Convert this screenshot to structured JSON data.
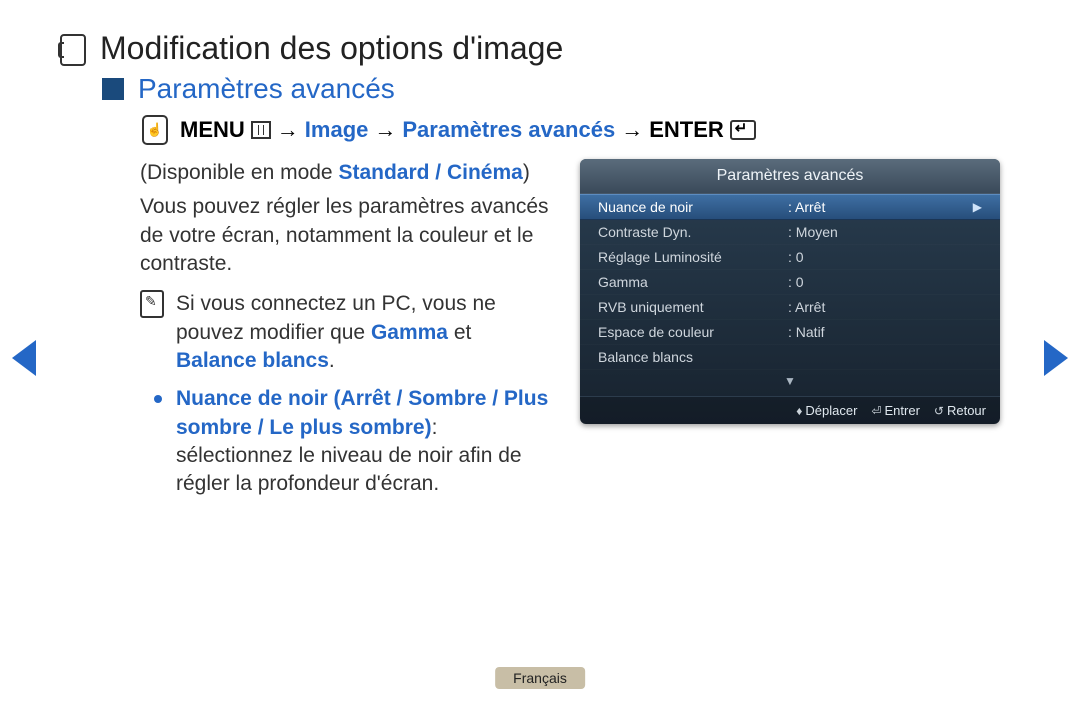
{
  "title": "Modification des options d'image",
  "subtitle": "Paramètres avancés",
  "breadcrumb": {
    "menu": "MENU",
    "arrow": "→",
    "path1": "Image",
    "path2": "Paramètres avancés",
    "enter": "ENTER"
  },
  "body": {
    "mode_prefix": "(Disponible en mode ",
    "mode1": "Standard",
    "mode_sep": " / ",
    "mode2": "Cinéma",
    "mode_suffix": ")",
    "para1": "Vous pouvez régler les paramètres avancés de votre écran, notamment la couleur et le contraste.",
    "note_prefix": "Si vous connectez un PC, vous ne pouvez modifier que ",
    "note_kw1": "Gamma",
    "note_join": " et ",
    "note_kw2": "Balance blancs",
    "note_suffix": ".",
    "bullet_title": "Nuance de noir (Arrêt / Sombre / Plus sombre / Le plus sombre)",
    "bullet_colon": ": ",
    "bullet_text": "sélectionnez le niveau de noir afin de régler la profondeur d'écran."
  },
  "osd": {
    "title": "Paramètres avancés",
    "items": [
      {
        "label": "Nuance de noir",
        "value": ": Arrêt"
      },
      {
        "label": "Contraste Dyn.",
        "value": ": Moyen"
      },
      {
        "label": "Réglage Luminosité",
        "value": ": 0"
      },
      {
        "label": "Gamma",
        "value": ": 0"
      },
      {
        "label": "RVB uniquement",
        "value": ": Arrêt"
      },
      {
        "label": "Espace de couleur",
        "value": ": Natif"
      },
      {
        "label": "Balance blancs",
        "value": ""
      }
    ],
    "down": "▼",
    "chevron": "▶",
    "footer": {
      "move": "Déplacer",
      "enter": "Entrer",
      "return": "Retour"
    }
  },
  "language": "Français"
}
